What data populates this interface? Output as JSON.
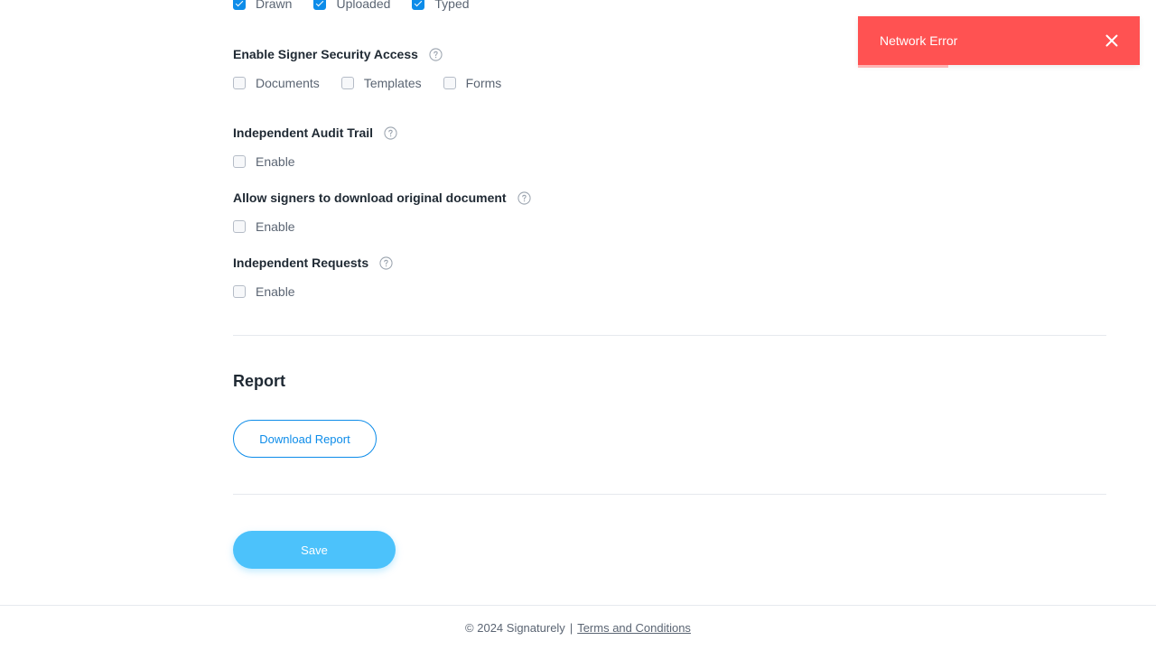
{
  "signature_types": {
    "items": [
      {
        "label": "Drawn",
        "checked": true
      },
      {
        "label": "Uploaded",
        "checked": true
      },
      {
        "label": "Typed",
        "checked": true
      }
    ]
  },
  "signer_security": {
    "title": "Enable Signer Security Access",
    "items": [
      {
        "label": "Documents",
        "checked": false
      },
      {
        "label": "Templates",
        "checked": false
      },
      {
        "label": "Forms",
        "checked": false
      }
    ]
  },
  "audit_trail": {
    "title": "Independent Audit Trail",
    "option_label": "Enable",
    "checked": false
  },
  "download_original": {
    "title": "Allow signers to download original document",
    "option_label": "Enable",
    "checked": false
  },
  "independent_requests": {
    "title": "Independent Requests",
    "option_label": "Enable",
    "checked": false
  },
  "report": {
    "heading": "Report",
    "download_label": "Download Report"
  },
  "save_label": "Save",
  "footer": {
    "copyright": "© 2024 Signaturely",
    "separator": "|",
    "terms_label": "Terms and Conditions"
  },
  "toast": {
    "message": "Network Error",
    "progress_fraction": 0.32,
    "color": "#ff5252"
  },
  "colors": {
    "accent": "#0d8ce9",
    "save_button": "#4cc2fb"
  },
  "icons": {
    "help": "question-circle-icon",
    "close": "close-icon",
    "check": "check-icon"
  }
}
